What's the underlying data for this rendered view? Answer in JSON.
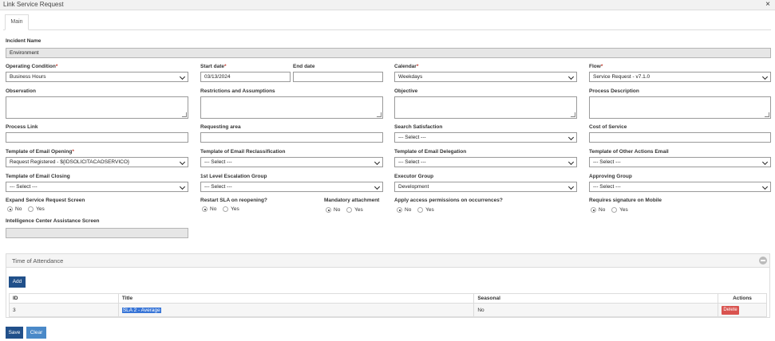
{
  "window": {
    "title": "Link Service Request",
    "close_glyph": "×"
  },
  "tabs": [
    {
      "label": "Main"
    }
  ],
  "incident": {
    "label": "Incident Name",
    "value": "Environment"
  },
  "operating_condition": {
    "label": "Operating Condition",
    "value": "Business Hours"
  },
  "start_date": {
    "label": "Start date",
    "value": "03/13/2024"
  },
  "end_date": {
    "label": "End date",
    "value": ""
  },
  "calendar": {
    "label": "Calendar",
    "value": "Weekdays"
  },
  "flow": {
    "label": "Flow",
    "value": "Service Request - v7.1.0"
  },
  "observation": {
    "label": "Observation",
    "value": ""
  },
  "restrictions": {
    "label": "Restrictions and Assumptions",
    "value": ""
  },
  "objective": {
    "label": "Objective",
    "value": ""
  },
  "process_description": {
    "label": "Process Description",
    "value": ""
  },
  "process_link": {
    "label": "Process Link",
    "value": ""
  },
  "requesting_area": {
    "label": "Requesting area",
    "value": ""
  },
  "search_satisfaction": {
    "label": "Search Satisfaction",
    "value": "--- Select ---"
  },
  "cost_of_service": {
    "label": "Cost of Service",
    "value": ""
  },
  "tpl_opening": {
    "label": "Template of Email Opening",
    "value": "Request Registered - ${IDSOLICITACAOSERVICO}"
  },
  "tpl_reclassification": {
    "label": "Template of Email Reclassification",
    "value": "--- Select ---"
  },
  "tpl_delegation": {
    "label": "Template of Email Delegation",
    "value": "--- Select ---"
  },
  "tpl_other": {
    "label": "Template of Other Actions Email",
    "value": "--- Select ---"
  },
  "tpl_closing": {
    "label": "Template of Email Closing",
    "value": "--- Select ---"
  },
  "escalation_group": {
    "label": "1st Level Escalation Group",
    "value": "--- Select ---"
  },
  "executor_group": {
    "label": "Executor Group",
    "value": "Development"
  },
  "approving_group": {
    "label": "Approving Group",
    "value": "--- Select ---"
  },
  "radios": {
    "no": "No",
    "yes": "Yes",
    "expand": "Expand Service Request Screen",
    "restart_sla": "Restart SLA on reopening?",
    "mandatory": "Mandatory attachment",
    "access_perm": "Apply access permissions on occurrences?",
    "signature": "Requires signature on Mobile"
  },
  "intelligence": {
    "label": "Intelligence Center Assistance Screen",
    "value": ""
  },
  "attendance": {
    "title": "Time of Attendance",
    "add_label": "Add",
    "columns": {
      "id": "ID",
      "title": "Title",
      "seasonal": "Seasonal",
      "actions": "Actions"
    },
    "rows": [
      {
        "id": "3",
        "title": "SLA 2 - Average",
        "seasonal": "No",
        "action": "Delete"
      }
    ]
  },
  "footer": {
    "save_label": "Save",
    "clear_label": "Clear"
  }
}
